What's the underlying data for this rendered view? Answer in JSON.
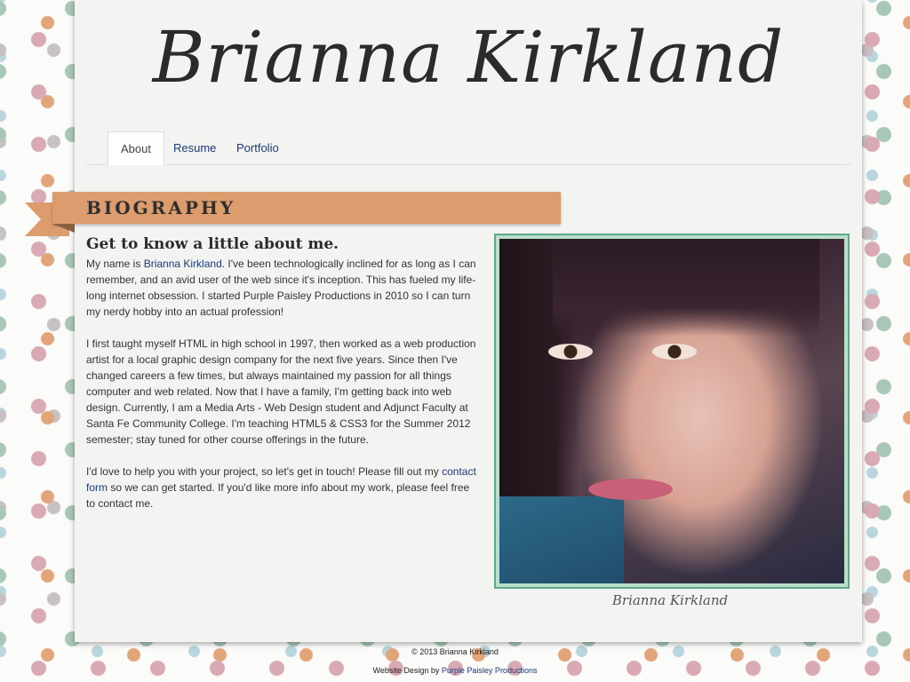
{
  "site": {
    "title": "Brianna Kirkland"
  },
  "nav": {
    "tabs": [
      {
        "label": "About",
        "active": true
      },
      {
        "label": "Resume",
        "active": false
      },
      {
        "label": "Portfolio",
        "active": false
      }
    ]
  },
  "section": {
    "ribbon_title": "BIOGRAPHY",
    "heading": "Get to know a little about me."
  },
  "bio": {
    "p1_a": "My name is ",
    "p1_link": "Brianna Kirkland",
    "p1_b": ". I've been technologically inclined for as long as I can remember, and an avid user of the web since it's inception. This has fueled my life-long internet obsession. I started Purple Paisley Productions in 2010 so I can turn my nerdy hobby into an actual profession!",
    "p2": "I first taught myself HTML in high school in 1997, then worked as a web production artist for a local graphic design company for the next five years. Since then I've changed careers a few times, but always maintained my passion for all things computer and web related. Now that I have a family, I'm getting back into web design. Currently, I am a Media Arts - Web Design student and Adjunct Faculty at Santa Fe Community College. I'm teaching HTML5 & CSS3 for the Summer 2012 semester; stay tuned for other course offerings in the future.",
    "p3_a": "I'd love to help you with your project, so let's get in touch! Please fill out my ",
    "p3_link": "contact form",
    "p3_b": " so we can get started. If you'd like more info about my work, please feel free to contact me."
  },
  "photo": {
    "caption": "Brianna Kirkland"
  },
  "footer": {
    "copyright": "© 2013 Brianna Kirkland",
    "credit_prefix": "Website Design by ",
    "credit_link": "Purple Paisley Productions"
  },
  "colors": {
    "ribbon": "#dd9c6e",
    "link": "#1a3a7a",
    "photo_border": "#5fa886"
  }
}
